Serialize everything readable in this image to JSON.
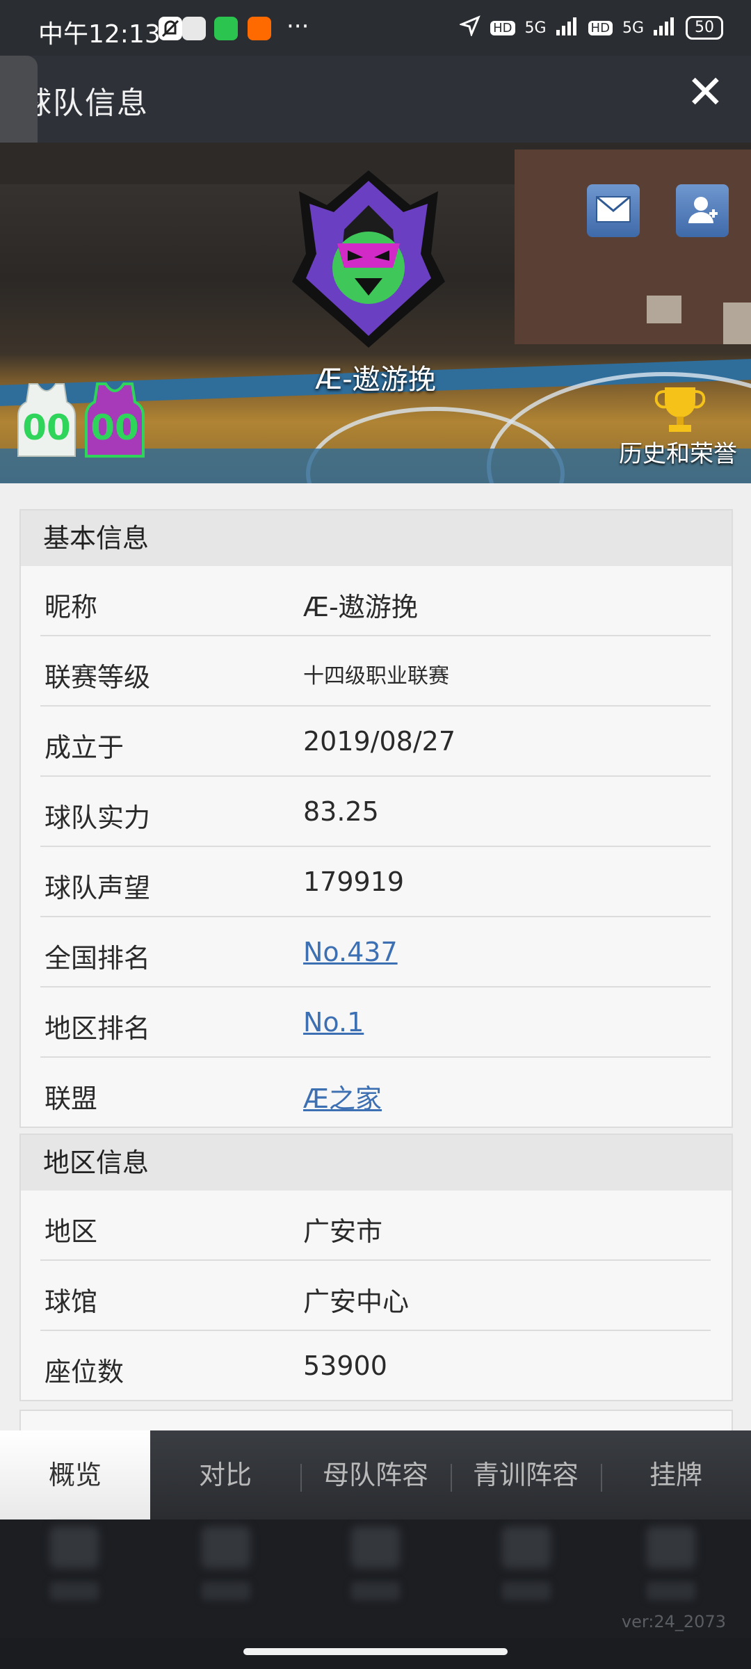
{
  "status_bar": {
    "time": "中午12:13",
    "battery": "50",
    "dots": "···",
    "net1": "5G",
    "net2": "5G",
    "hd": "HD"
  },
  "header": {
    "title": "球队信息",
    "close": "✕"
  },
  "banner": {
    "team_name": "Æ-遨游挽",
    "honor_label": "历史和荣誉",
    "jerseys": [
      {
        "number": "00",
        "color": "#2fd45a"
      },
      {
        "number": "00",
        "color": "#2fd45a"
      }
    ]
  },
  "basic_info": {
    "heading": "基本信息",
    "rows": [
      {
        "label": "昵称",
        "value": "Æ-遨游挽"
      },
      {
        "label": "联赛等级",
        "value": "十四级职业联赛"
      },
      {
        "label": "成立于",
        "value": "2019/08/27"
      },
      {
        "label": "球队实力",
        "value": "83.25"
      },
      {
        "label": "球队声望",
        "value": "179919"
      },
      {
        "label": "全国排名",
        "value": "No.437"
      },
      {
        "label": "地区排名",
        "value": "No.1"
      },
      {
        "label": "联盟",
        "value": "Æ之家"
      }
    ]
  },
  "region_info": {
    "heading": "地区信息",
    "rows": [
      {
        "label": "地区",
        "value": "广安市"
      },
      {
        "label": "球馆",
        "value": "广安中心"
      },
      {
        "label": "座位数",
        "value": "53900"
      }
    ]
  },
  "tabs": [
    {
      "label": "概览",
      "active": true
    },
    {
      "label": "对比"
    },
    {
      "label": "母队阵容"
    },
    {
      "label": "青训阵容"
    },
    {
      "label": "挂牌"
    }
  ],
  "version": "ver:24_2073",
  "colors": {
    "link": "#3d6fb3",
    "header_bg": "#2e3238",
    "jersey_green": "#2fd45a",
    "jersey_purple": "#a63ab8"
  }
}
